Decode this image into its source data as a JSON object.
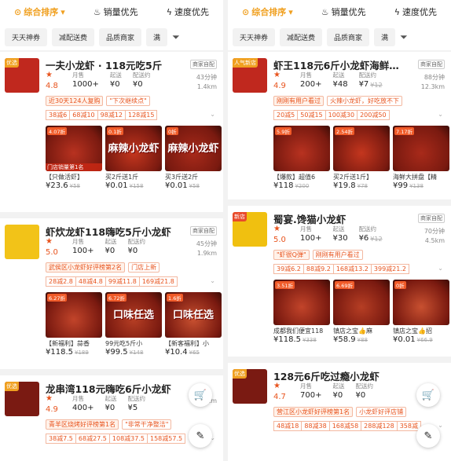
{
  "sort": {
    "comprehensive": "综合排序",
    "sales": "销量优先",
    "speed": "速度优先"
  },
  "filters": [
    "天天神券",
    "减配送费",
    "品质商家",
    "满"
  ],
  "left": [
    {
      "badge": "优选",
      "name": "一夫小龙虾 · 118元吃5斤",
      "tag": "商家自配",
      "score": "4.8",
      "m_sales": "1000+",
      "m_start": "¥0",
      "m_fee": "¥0",
      "label_sales": "月售",
      "label_start": "起送",
      "label_fee": "配送约",
      "time": "43分钟",
      "dist": "1.4km",
      "prom": [
        "近30天124人复购",
        "\"下次继续点\""
      ],
      "disc": [
        "38减6",
        "68减10",
        "98减12",
        "128减15"
      ],
      "dishes": [
        {
          "badge": "4.07折",
          "title": "",
          "name": "【只做活虾】",
          "price": "¥23.6",
          "orig": "¥58",
          "caption": "门店销量第1名"
        },
        {
          "badge": "0.1折",
          "title": "麻辣小龙虾",
          "name": "买2斤送1斤",
          "price": "¥0.01",
          "orig": "¥158",
          "caption": ""
        },
        {
          "badge": "0折",
          "title": "麻辣小龙虾",
          "name": "买3斤送2斤",
          "price": "¥0.01",
          "orig": "¥58",
          "caption": ""
        }
      ]
    },
    {
      "badge": "",
      "name": "虾炊龙虾118嗨吃5斤小龙虾",
      "tag": "商家自配",
      "score": "5.0",
      "m_sales": "100+",
      "m_start": "¥0",
      "m_fee": "¥0",
      "label_sales": "月售",
      "label_start": "起送",
      "label_fee": "配送约",
      "time": "45分钟",
      "dist": "1.9km",
      "prom": [
        "武侯区小龙虾好评榜第2名",
        "门店上新"
      ],
      "disc": [
        "28减2.8",
        "48减4.8",
        "99减11.8",
        "169减21.8"
      ],
      "dishes": [
        {
          "badge": "6.27折",
          "title": "",
          "name": "【新福利】蒜香",
          "price": "¥118.5",
          "orig": "¥189",
          "caption": ""
        },
        {
          "badge": "6.72折",
          "title": "口味任选",
          "name": "99元吃5斤小",
          "price": "¥99.5",
          "orig": "¥148",
          "caption": ""
        },
        {
          "badge": "1.6折",
          "title": "口味任选",
          "name": "【新客福利】小",
          "price": "¥10.4",
          "orig": "¥65",
          "caption": ""
        }
      ]
    },
    {
      "badge": "优选",
      "name": "龙串湾118元嗨吃6斤小龙虾",
      "tag": "",
      "score": "4.9",
      "m_sales": "400+",
      "m_start": "¥0",
      "m_fee": "¥5",
      "label_sales": "月售",
      "label_start": "起送",
      "label_fee": "配送约",
      "time": "",
      "dist": "8.0km",
      "prom": [
        "青羊区烧烤好评榜第1名",
        "\"非常干净整洁\""
      ],
      "disc": [
        "38减7.5",
        "68减27.5",
        "108减37.5",
        "158减57.5"
      ],
      "dishes": []
    }
  ],
  "right": [
    {
      "badge": "人气新店",
      "name": "虾王118元6斤小龙虾海鲜…",
      "tag": "商家自配",
      "score": "4.9",
      "m_sales": "200+",
      "m_start": "¥48",
      "m_fee": "¥7",
      "fee_orig": "¥12",
      "label_sales": "月售",
      "label_start": "起送",
      "label_fee": "配送约",
      "time": "88分钟",
      "dist": "12.3km",
      "prom": [
        "刚刚有用户看过",
        "火辣小龙虾，好吃放不下"
      ],
      "disc": [
        "20减5",
        "50减15",
        "100减30",
        "200减50"
      ],
      "dishes": [
        {
          "badge": "5.9折",
          "title": "",
          "name": "【爆款】超值6",
          "price": "¥118",
          "orig": "¥200",
          "caption": ""
        },
        {
          "badge": "2.54折",
          "title": "",
          "name": "买2斤送1斤】",
          "price": "¥19.8",
          "orig": "¥78",
          "caption": ""
        },
        {
          "badge": "7.17折",
          "title": "",
          "name": "海鲜大拼盘【精",
          "price": "¥99",
          "orig": "¥138",
          "caption": ""
        }
      ]
    },
    {
      "badge": "新店",
      "name": "蜀宴.馋猫小龙虾",
      "tag": "商家自配",
      "score": "5.0",
      "m_sales": "100+",
      "m_start": "¥30",
      "m_fee": "¥6",
      "fee_orig": "¥12",
      "label_sales": "月售",
      "label_start": "起送",
      "label_fee": "配送约",
      "time": "70分钟",
      "dist": "4.5km",
      "prom": [
        "\"虾很Q弹\"",
        "刚刚有用户看过"
      ],
      "disc": [
        "39减6.2",
        "88减9.2",
        "168减13.2",
        "399减21.2"
      ],
      "dishes": [
        {
          "badge": "3.51折",
          "title": "",
          "name": "成都我们便宜118",
          "price": "¥118.5",
          "orig": "¥338",
          "caption": ""
        },
        {
          "badge": "6.69折",
          "title": "",
          "name": "镇店之宝👍麻",
          "price": "¥58.9",
          "orig": "¥88",
          "caption": ""
        },
        {
          "badge": "0折",
          "title": "",
          "name": "镇店之宝👍招",
          "price": "¥0.01",
          "orig": "¥66.9",
          "caption": ""
        }
      ]
    },
    {
      "badge": "优选",
      "name": "128元6斤吃过瘾小龙虾",
      "tag": "",
      "score": "4.7",
      "m_sales": "700+",
      "m_start": "¥0",
      "m_fee": "¥0",
      "label_sales": "月售",
      "label_start": "起送",
      "label_fee": "配送约",
      "time": "",
      "dist": "",
      "prom": [
        "营江区小龙虾好评榜第1名",
        "小龙虾好评店铺"
      ],
      "disc": [
        "48减18",
        "88减38",
        "168减58",
        "288减128",
        "358减"
      ],
      "dishes": []
    }
  ]
}
